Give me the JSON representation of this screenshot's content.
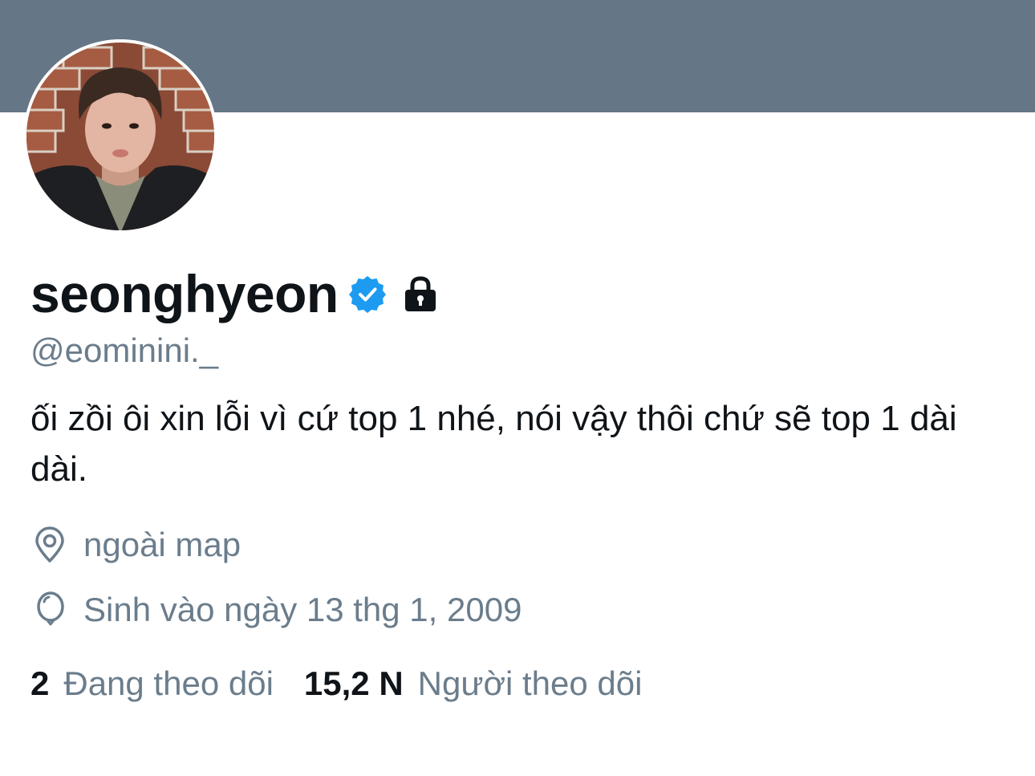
{
  "profile": {
    "display_name": "seonghyeon",
    "handle": "@eominini._",
    "bio": "ối zồi ôi xin lỗi vì cứ top 1 nhé, nói vậy thôi chứ sẽ top 1 dài dài.",
    "location": "ngoài map",
    "birth": "Sinh vào ngày 13 thg 1, 2009",
    "verified_icon": "verified-badge-icon",
    "lock_icon": "lock-icon"
  },
  "stats": {
    "following_count": "2",
    "following_label": "Đang theo dõi",
    "followers_count": "15,2 N",
    "followers_label": "Người theo dõi"
  },
  "colors": {
    "banner": "#657786",
    "verified": "#1d9bf0",
    "secondary_text": "#6b7d8c",
    "primary_text": "#0f1419"
  }
}
